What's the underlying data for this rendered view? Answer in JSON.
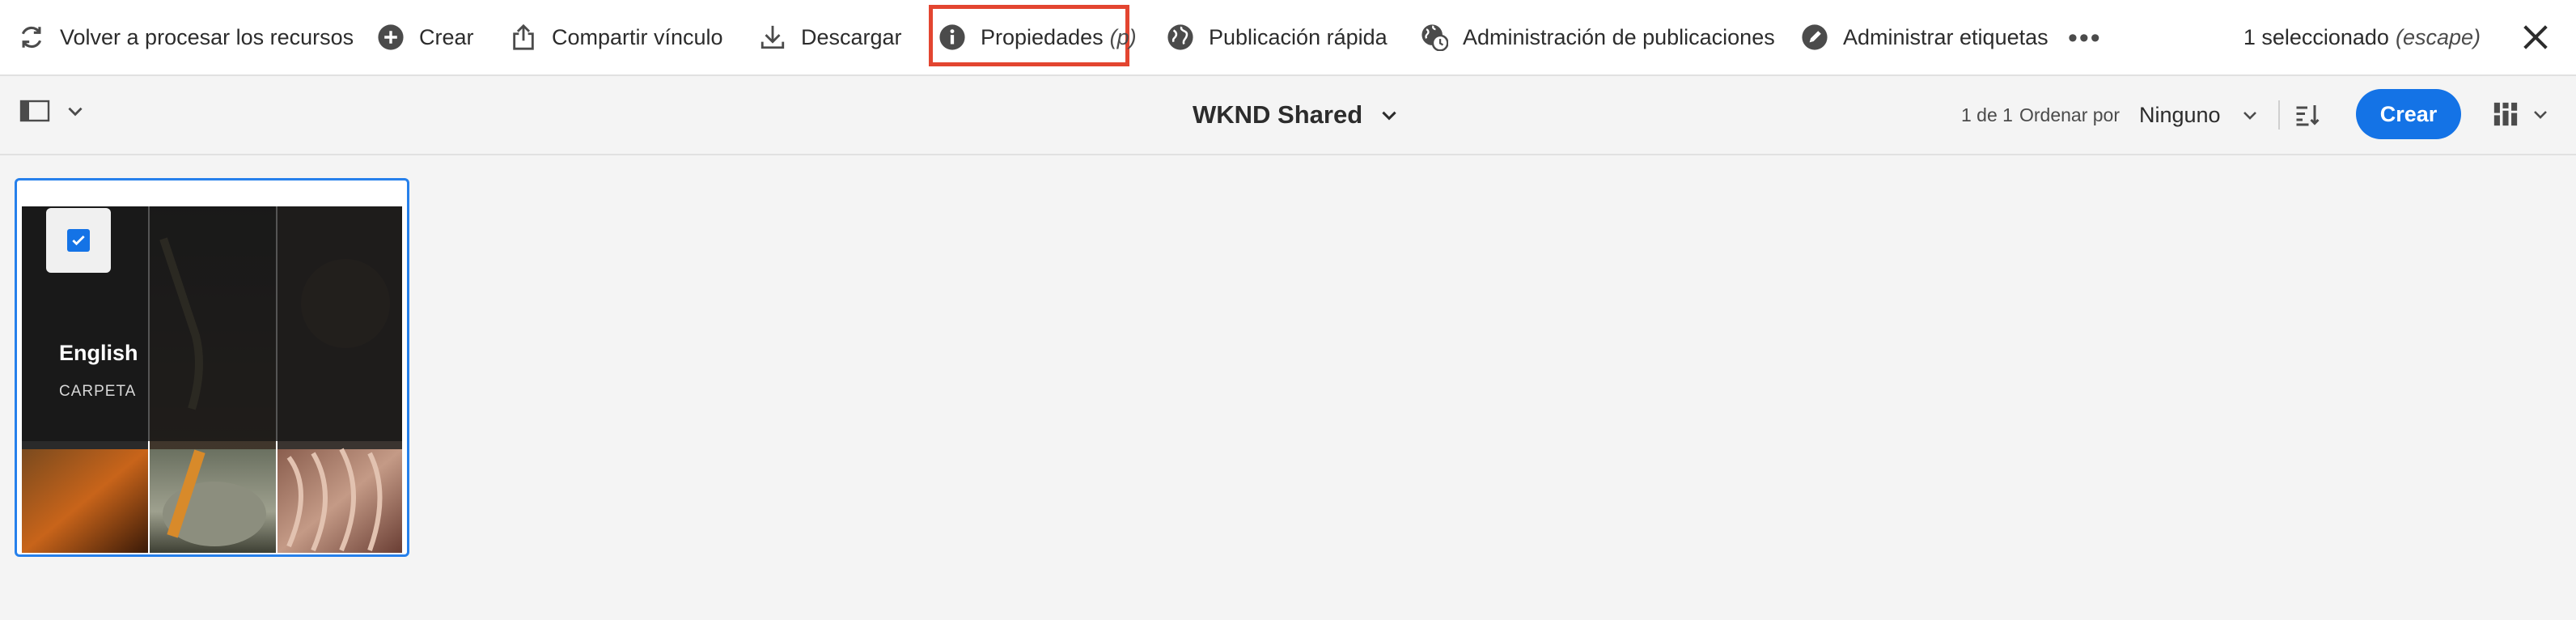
{
  "actionbar": {
    "reprocess": "Volver a procesar los recursos",
    "create": "Crear",
    "share_link": "Compartir vínculo",
    "download": "Descargar",
    "properties": "Propiedades",
    "properties_shortcut": "(p)",
    "quick_publish": "Publicación rápida",
    "manage_publication": "Administración de publicaciones",
    "manage_tags": "Administrar etiquetas",
    "more": "•••",
    "selection_count": "1 seleccionado",
    "selection_escape": "(escape)"
  },
  "subheader": {
    "title": "WKND Shared",
    "count": "1 de 1",
    "sort_label": "Ordenar por",
    "sort_value": "Ninguno",
    "create_button": "Crear"
  },
  "card": {
    "title": "English",
    "type": "CARPETA",
    "selected": true
  },
  "colors": {
    "accent": "#1473e6",
    "highlight": "#e34530",
    "selection_border": "#2680eb"
  },
  "icons": {
    "reprocess": "refresh-icon",
    "create": "add-circle-icon",
    "share": "share-icon",
    "download": "download-icon",
    "properties": "info-icon",
    "quick_publish": "globe-icon",
    "manage_publication": "globe-clock-icon",
    "manage_tags": "tag-edit-icon",
    "close": "close-icon",
    "rail": "rail-toggle-icon",
    "sort": "sort-order-icon",
    "view": "card-view-icon"
  }
}
